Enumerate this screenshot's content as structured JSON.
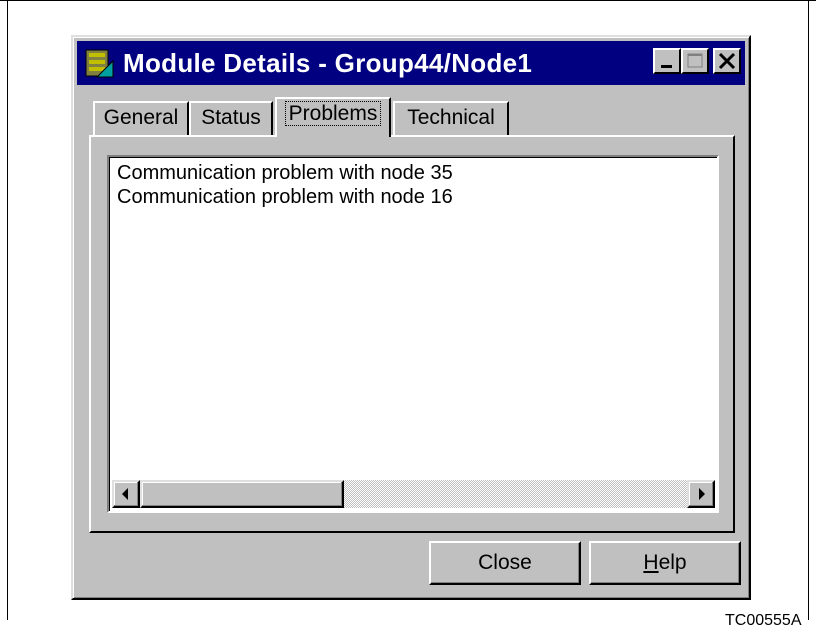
{
  "window": {
    "title": "Module Details - Group44/Node1",
    "icon": "module-details-icon",
    "controls": [
      "minimize-icon",
      "maximize-icon",
      "close-icon"
    ]
  },
  "tabs": [
    {
      "label": "General",
      "active": false
    },
    {
      "label": "Status",
      "active": false
    },
    {
      "label": "Problems",
      "active": true
    },
    {
      "label": "Technical",
      "active": false
    }
  ],
  "problems": {
    "items": [
      "Communication problem with node 35",
      "Communication problem with node 16"
    ]
  },
  "buttons": {
    "close_label": "Close",
    "help_label": "Help"
  },
  "caption": "TC00555A",
  "colors": {
    "titlebar": "#000080",
    "face": "#c0c0c0"
  }
}
